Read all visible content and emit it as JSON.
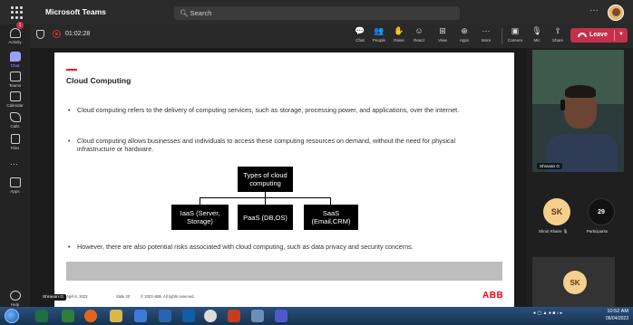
{
  "app": {
    "title": "Microsoft Teams",
    "search_placeholder": "Search",
    "more": "···"
  },
  "rail": {
    "items": [
      {
        "label": "Activity"
      },
      {
        "label": "Chat",
        "badge": "1"
      },
      {
        "label": "Teams"
      },
      {
        "label": "Calendar"
      },
      {
        "label": "Calls"
      },
      {
        "label": "Files"
      },
      {
        "label": "Apps"
      },
      {
        "label": "Help"
      }
    ],
    "more": "···"
  },
  "meeting": {
    "timer": "01:02:28",
    "tools": [
      {
        "label": "Chat",
        "icon": "chat-icon",
        "glyph": "💬"
      },
      {
        "label": "People",
        "icon": "people-icon",
        "glyph": "👥"
      },
      {
        "label": "Raise",
        "icon": "raise-hand-icon",
        "glyph": "✋"
      },
      {
        "label": "React",
        "icon": "react-icon",
        "glyph": "☺"
      },
      {
        "label": "View",
        "icon": "view-icon",
        "glyph": "⊞"
      },
      {
        "label": "Apps",
        "icon": "apps-icon",
        "glyph": "⊕"
      },
      {
        "label": "More",
        "icon": "more-icon",
        "glyph": "···"
      },
      {
        "label": "Camera",
        "icon": "camera-off-icon",
        "glyph": "▣"
      },
      {
        "label": "Mic",
        "icon": "mic-off-icon",
        "glyph": "🎙"
      },
      {
        "label": "Share",
        "icon": "share-icon",
        "glyph": "⇪"
      }
    ],
    "leave_label": "Leave"
  },
  "slide": {
    "title": "Cloud Computing",
    "bullets": [
      "Cloud computing refers to the delivery of computing services, such as storage, processing power, and applications, over the internet.",
      "Cloud computing allows businesses and individuals to access these computing resources on demand, without the need for physical infrastructure or hardware.",
      "However, there are also potential risks associated with cloud computing, such as data privacy and security concerns."
    ],
    "diagram": {
      "root": "Types of cloud computing",
      "children": [
        "IaaS (Server, Storage)",
        "PaaS (DB,OS)",
        "SaaS (Email,CRM)"
      ]
    },
    "footer": {
      "date": "April 6, 2023",
      "slide": "Slide 20",
      "copyright": "© 2023 ABB. All rights reserved."
    },
    "logo": "ABB",
    "presenter_tag": "Shravan G"
  },
  "participants": {
    "video_name": "Shravan G",
    "shruti": {
      "initials": "SK",
      "name": "Shruti Khaire"
    },
    "count": {
      "value": "29",
      "label": "Participants"
    },
    "self": {
      "initials": "SK"
    }
  },
  "taskbar": {
    "time": "10:52 AM",
    "date": "06/04/2023",
    "colors": {
      "accent": "#6264a7",
      "leave": "#c4314b",
      "abb_red": "#ff000f"
    }
  }
}
